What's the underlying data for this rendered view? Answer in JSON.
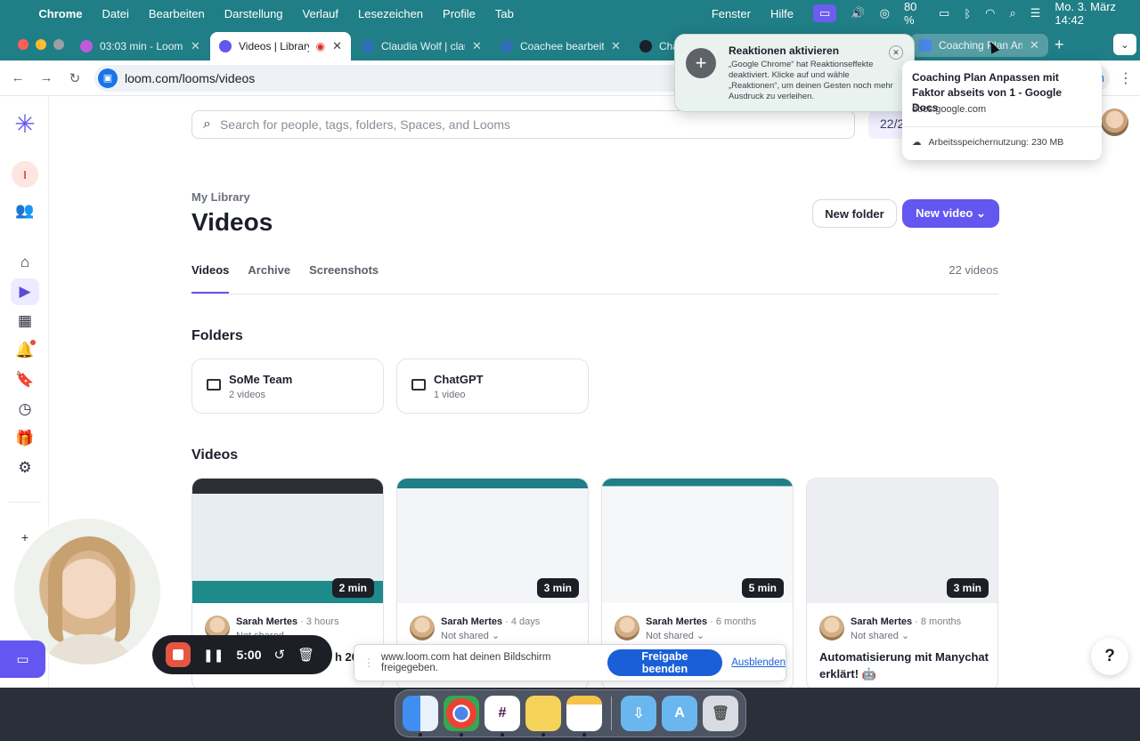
{
  "menubar": {
    "app": "Chrome",
    "items": [
      "Datei",
      "Bearbeiten",
      "Darstellung",
      "Verlauf",
      "Lesezeichen",
      "Profile",
      "Tab"
    ],
    "right_items": [
      "Fenster",
      "Hilfe"
    ],
    "battery": "80 %",
    "datetime": "Mo. 3. März 14:42"
  },
  "browser": {
    "tabs": [
      {
        "title": "03:03 min - Loom f",
        "favicon_color": "#c05ad9"
      },
      {
        "title": "Videos | Library",
        "favicon_color": "#6456f0",
        "active": true
      },
      {
        "title": "Claudia Wolf | clau",
        "favicon_color": "#2f6eb5"
      },
      {
        "title": "Coachee bearbeite",
        "favicon_color": "#2f6eb5"
      },
      {
        "title": "Cha",
        "favicon_color": "#1b1f2a"
      },
      {
        "title": "Coaching Plan Anp",
        "favicon_color": "#4a86e8"
      }
    ],
    "url": "loom.com/looms/videos",
    "url_suffix": "en"
  },
  "reaction_notification": {
    "title": "Reaktionen aktivieren",
    "body": "„Google Chrome“ hat Reaktionseffekte deaktiviert. Klicke auf  und wähle „Reaktionen“, um deinen Gesten noch mehr Ausdruck zu verleihen."
  },
  "tab_hovercard": {
    "title": "Coaching Plan Anpassen mit Faktor abseits von 1 - Google Docs",
    "domain": "docs.google.com",
    "memory": "Arbeitsspeichernutzung: 230 MB"
  },
  "search": {
    "placeholder": "Search for people, tags, folders, Spaces, and Looms"
  },
  "counter": "22/2",
  "breadcrumb": "My Library",
  "page_title": "Videos",
  "buttons": {
    "new_folder": "New folder",
    "new_video": "New video"
  },
  "tabs": {
    "videos": "Videos",
    "archive": "Archive",
    "screenshots": "Screenshots"
  },
  "video_count": "22 videos",
  "folders_heading": "Folders",
  "folders": [
    {
      "name": "SoMe Team",
      "count": "2 videos"
    },
    {
      "name": "ChatGPT",
      "count": "1 video"
    }
  ],
  "videos_heading": "Videos",
  "videos": [
    {
      "duration": "2 min",
      "author": "Sarah Mertes",
      "age": "· 3 hours",
      "share": "Not shared ⌄",
      "title": "h 20"
    },
    {
      "duration": "3 min",
      "author": "Sarah Mertes",
      "age": "· 4 days",
      "share": "Not shared ⌄",
      "title": ""
    },
    {
      "duration": "5 min",
      "author": "Sarah Mertes",
      "age": "· 6 months",
      "share": "Not shared ⌄",
      "title": ""
    },
    {
      "duration": "3 min",
      "author": "Sarah Mertes",
      "age": "· 8 months",
      "share": "Not shared ⌄",
      "title": "Automatisierung mit Manychat erklärt! 🤖"
    }
  ],
  "recorder": {
    "time": "5:00"
  },
  "share_bar": {
    "message": "www.loom.com hat deinen Bildschirm freigegeben.",
    "stop_label": "Freigabe beenden",
    "hide_label": "Ausblenden"
  },
  "help_label": "?",
  "colors": {
    "accent": "#6456f0",
    "menubar": "#1f7e86",
    "record_red": "#e5553f",
    "share_blue": "#1a5fd8"
  }
}
